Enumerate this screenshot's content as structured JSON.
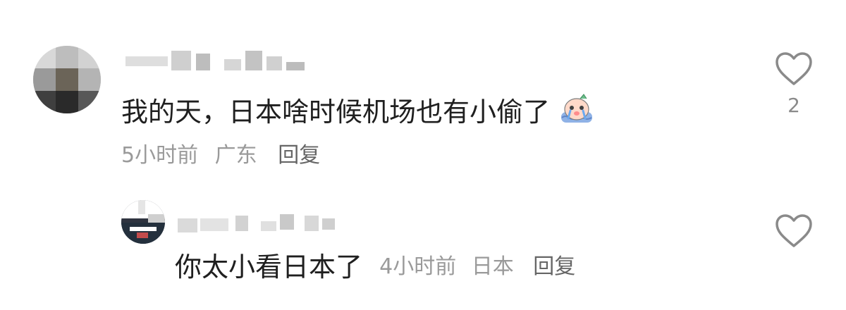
{
  "colors": {
    "text_primary": "#1f1f1f",
    "text_secondary": "#9a9a9a",
    "heart_outline": "#8a8a8a"
  },
  "comments": [
    {
      "text": "我的天，日本啥时候机场也有小偷了",
      "emoji_icon": "crying-face-emoji-icon",
      "time": "5小时前",
      "location": "广东",
      "reply_label": "回复",
      "like_icon": "heart-outline-icon",
      "like_count": "2"
    },
    {
      "text": "你太小看日本了",
      "time": "4小时前",
      "location": "日本",
      "reply_label": "回复",
      "like_icon": "heart-outline-icon"
    }
  ]
}
